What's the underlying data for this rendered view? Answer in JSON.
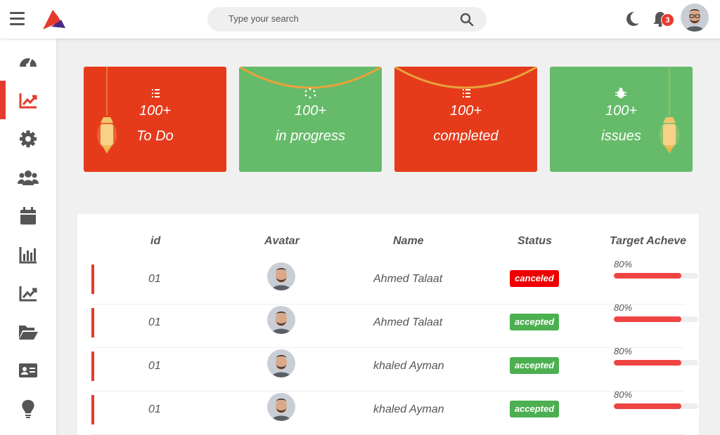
{
  "topbar": {
    "search_placeholder": "Type your search",
    "notification_count": "3",
    "brand_color": "#e53b2c"
  },
  "sidebar": {
    "items": [
      {
        "icon": "speedometer-icon",
        "active": false
      },
      {
        "icon": "chart-line-icon",
        "active": true
      },
      {
        "icon": "gear-icon",
        "active": false
      },
      {
        "icon": "users-icon",
        "active": false
      },
      {
        "icon": "calendar-icon",
        "active": false
      },
      {
        "icon": "bar-chart-icon",
        "active": false
      },
      {
        "icon": "chart-area-icon",
        "active": false
      },
      {
        "icon": "folder-open-icon",
        "active": false
      },
      {
        "icon": "id-card-icon",
        "active": false
      },
      {
        "icon": "lightbulb-icon",
        "active": false
      }
    ]
  },
  "cards": [
    {
      "icon": "list-check-icon",
      "count": "100+",
      "label": "To Do",
      "color": "#e53b1b"
    },
    {
      "icon": "spinner-icon",
      "count": "100+",
      "label": "in progress",
      "color": "#66bb6a"
    },
    {
      "icon": "list-check-icon",
      "count": "100+",
      "label": "completed",
      "color": "#e53b1b"
    },
    {
      "icon": "bug-icon",
      "count": "100+",
      "label": "issues",
      "color": "#66bb6a"
    }
  ],
  "table": {
    "headers": {
      "id": "id",
      "avatar": "Avatar",
      "name": "Name",
      "status": "Status",
      "target": "Target Acheve"
    },
    "rows": [
      {
        "id": "01",
        "name": "Ahmed Talaat",
        "status": "canceled",
        "target_label": "80%",
        "target": 0.8
      },
      {
        "id": "01",
        "name": "Ahmed Talaat",
        "status": "accepted",
        "target_label": "80%",
        "target": 0.8
      },
      {
        "id": "01",
        "name": "khaled Ayman",
        "status": "accepted",
        "target_label": "80%",
        "target": 0.8
      },
      {
        "id": "01",
        "name": "khaled Ayman",
        "status": "accepted",
        "target_label": "80%",
        "target": 0.8
      }
    ]
  }
}
